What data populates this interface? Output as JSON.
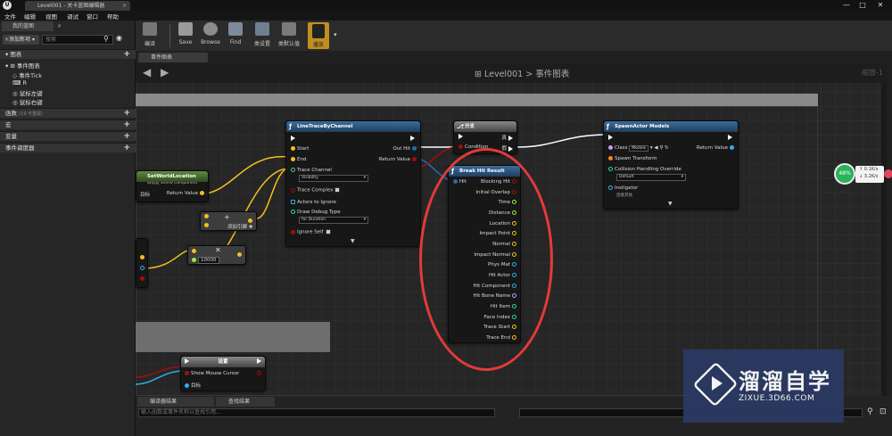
{
  "window": {
    "tab_title": "Level001 - 关卡蓝图编辑器",
    "controls": [
      "—",
      "□",
      "✕"
    ]
  },
  "menu": [
    "文件",
    "编辑",
    "视图",
    "调试",
    "窗口",
    "帮助"
  ],
  "left_panel": {
    "tab": "我的蓝图",
    "add_new": "添加新项",
    "search_placeholder": "搜索",
    "sections": {
      "graph": "图表",
      "functions": "函数",
      "functions_count": "(19 可重载)",
      "macros": "宏",
      "variables": "变量",
      "dispatchers": "事件调度器"
    },
    "tree": {
      "event_graph": "事件图表",
      "items": [
        "事件Tick",
        "R",
        "鼠标左键",
        "鼠标右键"
      ]
    }
  },
  "toolbar": {
    "compile": "编译",
    "save": "Save",
    "browse": "Browse",
    "find": "Find",
    "class_settings": "类设置",
    "class_defaults": "类默认值",
    "play": "播放"
  },
  "graph": {
    "tab": "事件图表",
    "breadcrumb_level": "Level001",
    "breadcrumb_sep": ">",
    "breadcrumb_graph": "事件图表",
    "zoom": "缩放-1"
  },
  "nodes": {
    "line_trace": {
      "title": "LineTraceByChannel",
      "start": "Start",
      "end": "End",
      "trace_channel": "Trace Channel",
      "trace_channel_value": "Visibility",
      "trace_complex": "Trace Complex",
      "actors_to_ignore": "Actors to Ignore",
      "draw_debug": "Draw Debug Type",
      "draw_debug_value": "for Duration",
      "ignore_self": "Ignore Self",
      "out_hit": "Out Hit",
      "return_value": "Return Value"
    },
    "set_world": {
      "title": "SetWorldLocation",
      "subtitle": "目标是 Scene Component",
      "target": "目标",
      "return_value": "Return Value"
    },
    "add_pin": {
      "label": "添加引脚"
    },
    "multiply": {
      "value": "10000"
    },
    "branch": {
      "title": "分支",
      "condition": "Condition",
      "true_label": "真",
      "false_label": "假"
    },
    "break_hit": {
      "title": "Break Hit Result",
      "hit": "Hit",
      "outputs": [
        "Blocking Hit",
        "Initial Overlap",
        "Time",
        "Distance",
        "Location",
        "Impact Point",
        "Normal",
        "Impact Normal",
        "Phys Mat",
        "Hit Actor",
        "Hit Component",
        "Hit Bone Name",
        "Hit Item",
        "Face Index",
        "Trace Start",
        "Trace End"
      ]
    },
    "spawn": {
      "title": "SpawnActor Models",
      "class": "Class",
      "class_value": "Models",
      "spawn_transform": "Spawn Transform",
      "collision": "Collision Handling Override",
      "collision_value": "Default",
      "instigator": "Instigator",
      "instigator_value": "连接其他",
      "return_value": "Return Value"
    },
    "set_node": {
      "title": "设置",
      "show_cursor": "Show Mouse Cursor",
      "target": "目标"
    }
  },
  "stats": {
    "percent": "48%",
    "up": "0.1K/s",
    "down": "3.2K/s"
  },
  "bottom": {
    "tab1": "编译器结果",
    "tab2": "查找结果",
    "search_placeholder": "输入函数或事件名称以查找引用..."
  },
  "watermark": {
    "title": "溜溜自学",
    "subtitle": "ZIXUE.3D66.COM"
  },
  "colors": {
    "exec": "#ffffff",
    "vector": "#f2c01e",
    "struct": "#1f6fb3",
    "bool": "#a10e0e",
    "float": "#a2ea4a",
    "object": "#2fb0e8",
    "name": "#c89bf0",
    "int": "#2ad7a0",
    "annotation": "#e33a3a"
  }
}
